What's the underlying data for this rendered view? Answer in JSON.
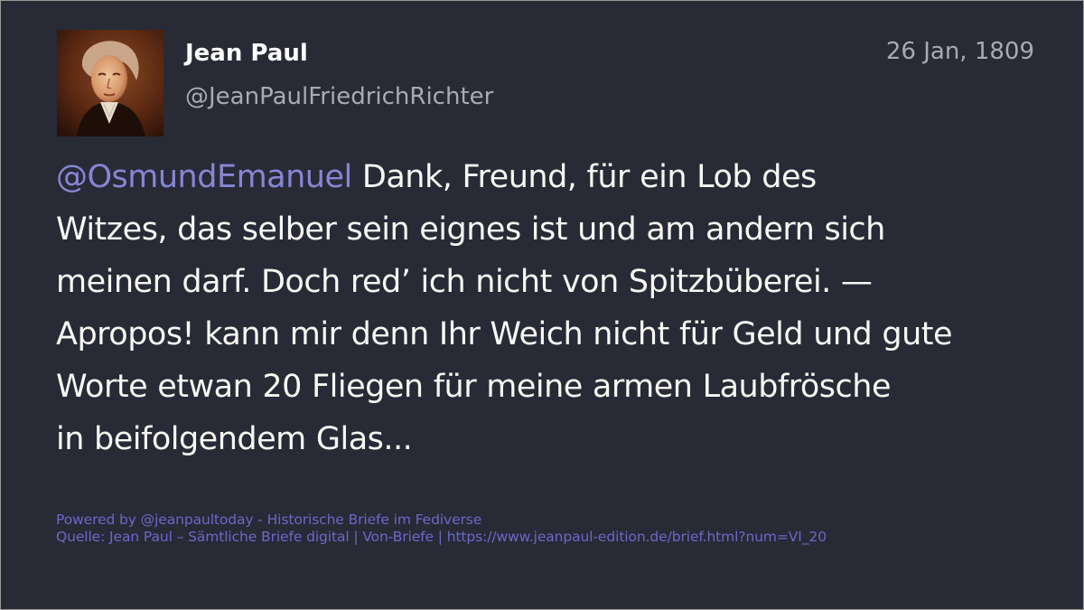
{
  "post": {
    "author_name": "Jean Paul",
    "author_handle": "@JeanPaulFriedrichRichter",
    "date": "26 Jan, 1809",
    "avatar_icon": "portrait-avatar",
    "mention": "@OsmundEmanuel",
    "lines": [
      " Dank, Freund, für ein Lob des",
      "Witzes, das selber sein eignes ist und am andern sich",
      "meinen darf. Doch red’ ich nicht von Spitzbüberei. —",
      "Apropos! kann mir denn Ihr Weich nicht für Geld und gute",
      "Worte etwan 20 Fliegen für meine armen Laubfrösche",
      "in beifolgendem Glas..."
    ]
  },
  "footer": {
    "powered_by": "Powered by @jeanpaultoday - Historische Briefe im Fediverse",
    "source": "Quelle: Jean Paul – Sämtliche Briefe digital | Von-Briefe | https://www.jeanpaul-edition.de/brief.html?num=VI_20"
  },
  "colors": {
    "background": "#282a36",
    "text": "#f8f8f2",
    "muted": "#a9aab3",
    "mention": "#8785d4",
    "footer_link": "#6b68c9"
  }
}
